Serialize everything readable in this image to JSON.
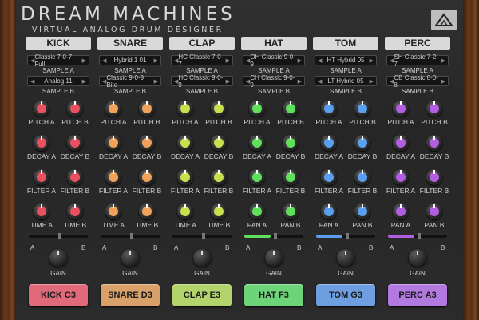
{
  "app": {
    "title": "DREAM MACHINES",
    "subtitle": "VIRTUAL ANALOG DRUM DESIGNER",
    "logo_icon": "triangle-logo-icon"
  },
  "channels": [
    {
      "name": "KICK",
      "color": "#e8505f",
      "sample_a": "Classic 7-0-7 Full",
      "sample_a_label": "SAMPLE A",
      "sample_b": "Analog 11",
      "sample_b_label": "SAMPLE B",
      "knobs": [
        {
          "label": "PITCH A"
        },
        {
          "label": "PITCH B"
        },
        {
          "label": "DECAY A"
        },
        {
          "label": "DECAY B"
        },
        {
          "label": "FILTER A"
        },
        {
          "label": "FILTER B"
        },
        {
          "label": "TIME A"
        },
        {
          "label": "TIME B"
        }
      ],
      "ab_mix": 0.5,
      "a_label": "A",
      "b_label": "B",
      "gain_label": "GAIN",
      "pad_label": "KICK C3",
      "pad_color": "#e0697a"
    },
    {
      "name": "SNARE",
      "color": "#f0a25a",
      "sample_a": "Hybrid 1 01",
      "sample_a_label": "SAMPLE A",
      "sample_b": "Classic 9-0-9 Bite",
      "sample_b_label": "SAMPLE B",
      "knobs": [
        {
          "label": "PITCH A"
        },
        {
          "label": "PITCH B"
        },
        {
          "label": "DECAY A"
        },
        {
          "label": "DECAY B"
        },
        {
          "label": "FILTER A"
        },
        {
          "label": "FILTER B"
        },
        {
          "label": "TIME A"
        },
        {
          "label": "TIME B"
        }
      ],
      "ab_mix": 0.5,
      "a_label": "A",
      "b_label": "B",
      "gain_label": "GAIN",
      "pad_label": "SNARE D3",
      "pad_color": "#d9a06a"
    },
    {
      "name": "CLAP",
      "color": "#c6e04e",
      "sample_a": "HC Classic 7-0-7",
      "sample_a_label": "SAMPLE A",
      "sample_b": "HC Classic 9-0-9",
      "sample_b_label": "SAMPLE B",
      "knobs": [
        {
          "label": "PITCH A"
        },
        {
          "label": "PITCH B"
        },
        {
          "label": "DECAY A"
        },
        {
          "label": "DECAY B"
        },
        {
          "label": "FILTER A"
        },
        {
          "label": "FILTER B"
        },
        {
          "label": "TIME A"
        },
        {
          "label": "TIME B"
        }
      ],
      "ab_mix": 0.5,
      "a_label": "A",
      "b_label": "B",
      "gain_label": "GAIN",
      "pad_label": "CLAP E3",
      "pad_color": "#b3d46a"
    },
    {
      "name": "HAT",
      "color": "#5ee05a",
      "sample_a": "OH Classic 9-0-9",
      "sample_a_label": "SAMPLE A",
      "sample_b": "CH Classic 9-0-9",
      "sample_b_label": "SAMPLE B",
      "knobs": [
        {
          "label": "PITCH A"
        },
        {
          "label": "PITCH B"
        },
        {
          "label": "DECAY A"
        },
        {
          "label": "DECAY B"
        },
        {
          "label": "FILTER A"
        },
        {
          "label": "FILTER B"
        },
        {
          "label": "PAN A"
        },
        {
          "label": "PAN B"
        }
      ],
      "ab_mix": 0.5,
      "a_label": "A",
      "b_label": "B",
      "gain_label": "GAIN",
      "pad_label": "HAT F3",
      "pad_color": "#6ed47a"
    },
    {
      "name": "TOM",
      "color": "#5a9ef0",
      "sample_a": "HT Hybrid 05",
      "sample_a_label": "SAMPLE A",
      "sample_b": "LT Hybrid 05",
      "sample_b_label": "SAMPLE B",
      "knobs": [
        {
          "label": "PITCH A"
        },
        {
          "label": "PITCH B"
        },
        {
          "label": "DECAY A"
        },
        {
          "label": "DECAY B"
        },
        {
          "label": "FILTER A"
        },
        {
          "label": "FILTER B"
        },
        {
          "label": "PAN A"
        },
        {
          "label": "PAN B"
        }
      ],
      "ab_mix": 0.5,
      "a_label": "A",
      "b_label": "B",
      "gain_label": "GAIN",
      "pad_label": "TOM G3",
      "pad_color": "#6f9ee0"
    },
    {
      "name": "PERC",
      "color": "#b25ee0",
      "sample_a": "SH Classic 7-2-7",
      "sample_a_label": "SAMPLE A",
      "sample_b": "CB Classic 8-0-8",
      "sample_b_label": "SAMPLE B",
      "knobs": [
        {
          "label": "PITCH A"
        },
        {
          "label": "PITCH B"
        },
        {
          "label": "DECAY A"
        },
        {
          "label": "DECAY B"
        },
        {
          "label": "FILTER A"
        },
        {
          "label": "FILTER B"
        },
        {
          "label": "PAN A"
        },
        {
          "label": "PAN B"
        }
      ],
      "ab_mix": 0.5,
      "a_label": "A",
      "b_label": "B",
      "gain_label": "GAIN",
      "pad_label": "PERC A3",
      "pad_color": "#b27ae0"
    }
  ]
}
